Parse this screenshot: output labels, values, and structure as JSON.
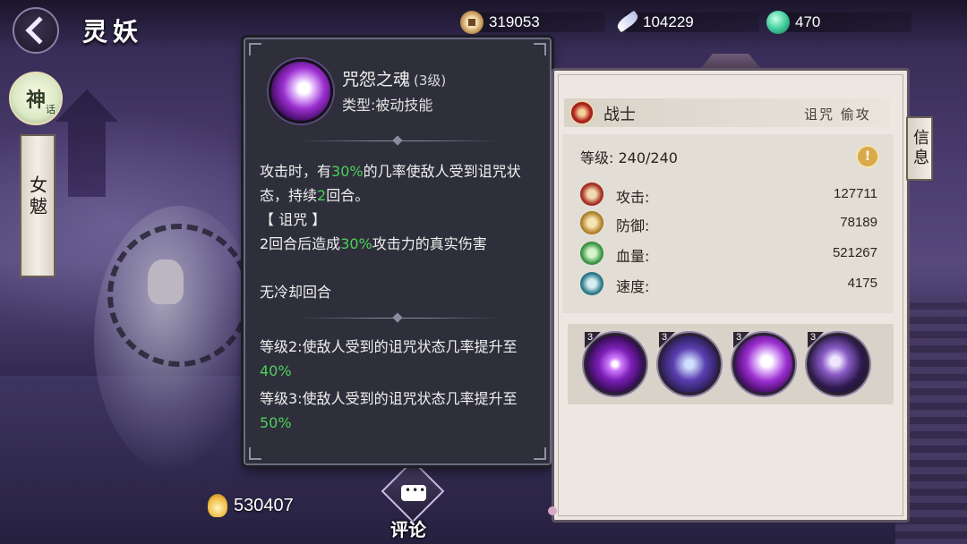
{
  "header": {
    "title": "灵妖",
    "currencies": [
      {
        "icon": "coin-icon",
        "value": "319053"
      },
      {
        "icon": "feather-icon",
        "value": "104229"
      },
      {
        "icon": "jade-icon",
        "value": "470"
      }
    ]
  },
  "left": {
    "rank_badge": "神",
    "rank_badge_sub": "话",
    "spirit_name": "女魃",
    "soul_total": "530407",
    "comment_label": "评论"
  },
  "tooltip": {
    "skill_name": "咒怨之魂",
    "skill_level": "(3级)",
    "skill_type": "类型:被动技能",
    "desc_1_a": "攻击时，有",
    "desc_1_hl": "30%",
    "desc_1_b": "的几率使敌人受到诅咒状态，持续",
    "desc_1_hl2": "2",
    "desc_1_c": "回合。",
    "tag": "【 诅咒 】",
    "desc_2_a": "2回合后造成",
    "desc_2_hl": "30%",
    "desc_2_b": "攻击力的真实伤害",
    "desc_3": "无冷却回合",
    "upgrade_1_a": "等级2:使敌人受到的诅咒状态几率提升至",
    "upgrade_1_hl": "40%",
    "upgrade_2_a": "等级3:使敌人受到的诅咒状态几率提升至",
    "upgrade_2_hl": "50%"
  },
  "panel": {
    "class_name": "战士",
    "class_tags": "诅咒 偷攻",
    "info_tab": "信息",
    "level": "等级: 240/240",
    "level_hint": "!",
    "stats": [
      {
        "icon": "attack-icon",
        "label": "攻击:",
        "value": "127711"
      },
      {
        "icon": "defense-icon",
        "label": "防御:",
        "value": "78189"
      },
      {
        "icon": "hp-icon",
        "label": "血量:",
        "value": "521267"
      },
      {
        "icon": "speed-icon",
        "label": "速度:",
        "value": "4175"
      }
    ],
    "skills": [
      {
        "level": "3"
      },
      {
        "level": "3"
      },
      {
        "level": "3"
      },
      {
        "level": "3"
      }
    ]
  }
}
